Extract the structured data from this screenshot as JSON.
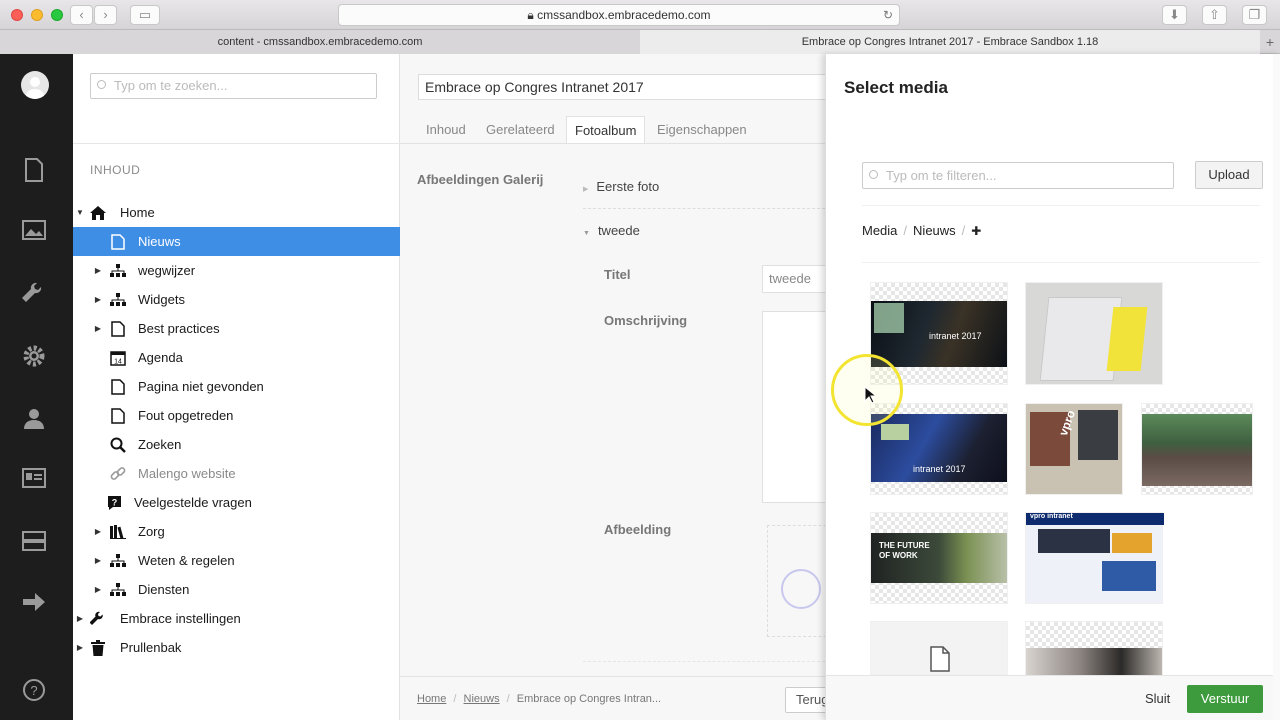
{
  "browser": {
    "url": "cmssandbox.embracedemo.com",
    "tabs": [
      {
        "label": "content - cmssandbox.embracedemo.com"
      },
      {
        "label": "Embrace op Congres Intranet 2017 - Embrace Sandbox 1.18"
      }
    ]
  },
  "tree": {
    "search_placeholder": "Typ om te zoeken...",
    "heading": "INHOUD",
    "items": [
      {
        "label": "Home"
      },
      {
        "label": "Nieuws"
      },
      {
        "label": "wegwijzer"
      },
      {
        "label": "Widgets"
      },
      {
        "label": "Best practices"
      },
      {
        "label": "Agenda"
      },
      {
        "label": "Pagina niet gevonden"
      },
      {
        "label": "Fout opgetreden"
      },
      {
        "label": "Zoeken"
      },
      {
        "label": "Malengo website"
      },
      {
        "label": "Veelgestelde vragen"
      },
      {
        "label": "Zorg"
      },
      {
        "label": "Weten & regelen"
      },
      {
        "label": "Diensten"
      },
      {
        "label": "Embrace instellingen"
      },
      {
        "label": "Prullenbak"
      }
    ]
  },
  "editor": {
    "title": "Embrace op Congres Intranet 2017",
    "tabs": [
      "Inhoud",
      "Gerelateerd",
      "Fotoalbum",
      "Eigenschappen"
    ],
    "section_label": "Afbeeldingen Galerij",
    "first_photo": "Eerste foto",
    "second": "tweede",
    "title_label": "Titel",
    "title_value": "tweede",
    "description_label": "Omschrijving",
    "image_label": "Afbeelding",
    "breadcrumb": [
      "Home",
      "Nieuws",
      "Embrace op Congres Intran..."
    ],
    "back_label": "Terug"
  },
  "media": {
    "title": "Select media",
    "filter_placeholder": "Typ om te filteren...",
    "upload_label": "Upload",
    "breadcrumb": [
      "Media",
      "Nieuws"
    ],
    "add_symbol": "✚",
    "thumb_texts": {
      "t1": "intranet 2017",
      "t3": "intranet 2017",
      "t4": "vpro",
      "t6a": "THE FUTURE",
      "t6b": "OF WORK",
      "t7": "vpro intranet"
    },
    "close_label": "Sluit",
    "submit_label": "Verstuur"
  }
}
